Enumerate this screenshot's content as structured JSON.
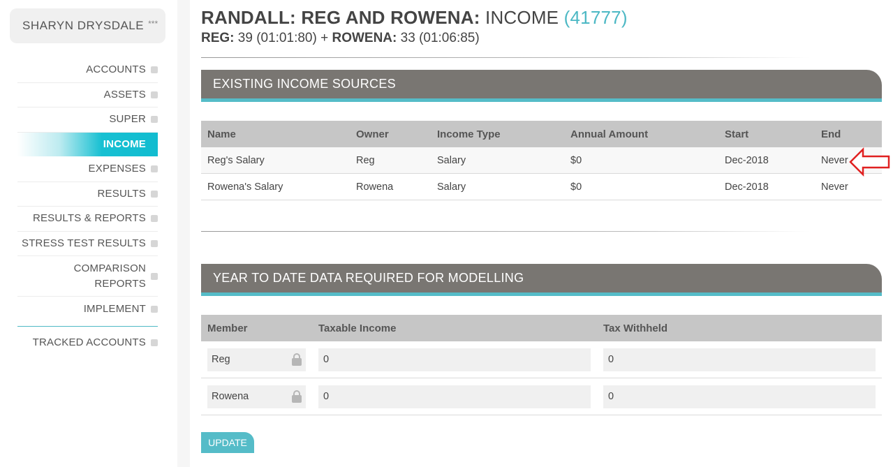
{
  "sidebar": {
    "user_name": "SHARYN DRYSDALE",
    "user_stars": "***",
    "items": [
      {
        "label": "ACCOUNTS"
      },
      {
        "label": "ASSETS"
      },
      {
        "label": "SUPER"
      },
      {
        "label": "INCOME"
      },
      {
        "label": "EXPENSES"
      },
      {
        "label": "RESULTS"
      },
      {
        "label": "RESULTS & REPORTS"
      },
      {
        "label": "STRESS TEST RESULTS"
      },
      {
        "label": "COMPARISON REPORTS"
      },
      {
        "label": "IMPLEMENT"
      }
    ],
    "tracked_label": "TRACKED ACCOUNTS",
    "active_item": "INCOME"
  },
  "header": {
    "title_bold": "RANDALL: REG AND ROWENA:",
    "title_section": "INCOME",
    "title_id": "(41777)",
    "sub_reg_label": "REG:",
    "sub_reg_value": "39 (01:01:80)",
    "sub_plus": "+",
    "sub_rowena_label": "ROWENA:",
    "sub_rowena_value": "33 (01:06:85)"
  },
  "income_sources": {
    "title": "EXISTING INCOME SOURCES",
    "columns": [
      "Name",
      "Owner",
      "Income Type",
      "Annual Amount",
      "Start",
      "End"
    ],
    "rows": [
      {
        "name": "Reg's Salary",
        "owner": "Reg",
        "type": "Salary",
        "amount": "$0",
        "start": "Dec-2018",
        "end": "Never"
      },
      {
        "name": "Rowena's Salary",
        "owner": "Rowena",
        "type": "Salary",
        "amount": "$0",
        "start": "Dec-2018",
        "end": "Never"
      }
    ]
  },
  "ytd": {
    "title": "YEAR TO DATE DATA REQUIRED FOR MODELLING",
    "columns": [
      "Member",
      "Taxable Income",
      "Tax Withheld"
    ],
    "rows": [
      {
        "member": "Reg",
        "taxable": "0",
        "withheld": "0"
      },
      {
        "member": "Rowena",
        "taxable": "0",
        "withheld": "0"
      }
    ],
    "update_label": "UPDATE"
  },
  "colors": {
    "accent": "#55bcc8",
    "active_nav": "#17c0d2",
    "panel_header": "#797672",
    "annotation_arrow": "#e02020"
  }
}
